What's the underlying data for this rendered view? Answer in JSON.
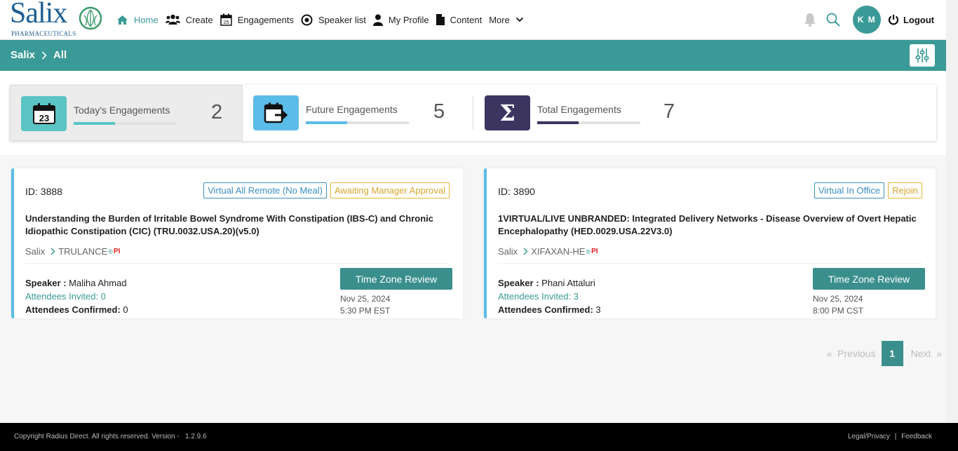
{
  "brand": {
    "name": "Salix",
    "subtitle": "PHARMACEUTICALS"
  },
  "nav": [
    {
      "label": "Home",
      "icon": "home-icon",
      "active": true
    },
    {
      "label": "Create",
      "icon": "users-icon"
    },
    {
      "label": "Engagements",
      "icon": "calendar-icon"
    },
    {
      "label": "Speaker list",
      "icon": "target-icon"
    },
    {
      "label": "My Profile",
      "icon": "user-icon"
    },
    {
      "label": "Content",
      "icon": "file-icon"
    },
    {
      "label": "More",
      "icon": "chevron-down-icon"
    }
  ],
  "user": {
    "initials": "K M",
    "logout_label": "Logout"
  },
  "breadcrumb": {
    "root": "Salix",
    "current": "All"
  },
  "stats": [
    {
      "label": "Today's Engagements",
      "value": "2",
      "icon_day": "23",
      "accent": "#5bc4c4",
      "progress": 0.4
    },
    {
      "label": "Future Engagements",
      "value": "5",
      "accent": "#5bbce8",
      "progress": 0.4
    },
    {
      "label": "Total Engagements",
      "value": "7",
      "symbol": "Σ",
      "accent": "#3c3560",
      "progress": 0.4
    }
  ],
  "cards": [
    {
      "id": "ID: 3888",
      "tags": [
        "Virtual All Remote (No Meal)",
        "Awaiting Manager Approval"
      ],
      "title": "Understanding the Burden of Irritable Bowel Syndrome With Constipation (IBS-C) and Chronic Idiopathic Constipation (CIC) (TRU.0032.USA.20)(v5.0)",
      "company": "Salix",
      "product": "TRULANCE",
      "reg": "®",
      "pi": "PI",
      "speaker_label": "Speaker :",
      "speaker": "Maliha Ahmad",
      "invited": "Attendees Invited: 0",
      "confirmed_label": "Attendees Confirmed:",
      "confirmed": "0",
      "button": "Time Zone Review",
      "date": "Nov 25, 2024",
      "time": "5:30 PM EST"
    },
    {
      "id": "ID: 3890",
      "tags": [
        "Virtual In Office",
        "Rejoin"
      ],
      "title": "1VIRTUAL/LIVE UNBRANDED: Integrated Delivery Networks - Disease Overview of Overt Hepatic Encephalopathy (HED.0029.USA.22V3.0)",
      "company": "Salix",
      "product": "XIFAXAN-HE",
      "reg": "®",
      "pi": "PI",
      "speaker_label": "Speaker :",
      "speaker": "Phani Attaluri",
      "invited": "Attendees Invited: 3",
      "confirmed_label": "Attendees Confirmed:",
      "confirmed": "3",
      "button": "Time Zone Review",
      "date": "Nov 25, 2024",
      "time": "8:00 PM CST"
    }
  ],
  "pagination": {
    "prev": "«  Previous",
    "page": "1",
    "next": "Next  »"
  },
  "footer": {
    "copyright": "Copyright Radius Direct. All rights reserved. Version -   1.2.9.6",
    "legal": "Legal/Privacy",
    "sep": "|",
    "feedback": "Feedback"
  }
}
